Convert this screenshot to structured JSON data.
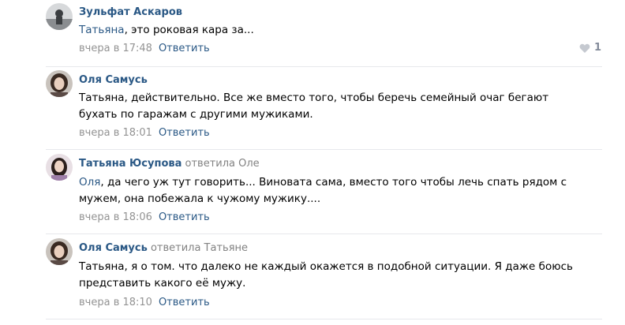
{
  "comments": [
    {
      "author": "Зульфат Аскаров",
      "reply_to": "",
      "mention": "Татьяна",
      "text": ", это роковая кара за...",
      "date": "вчера в 17:48",
      "reply_label": "Ответить",
      "likes": "1"
    },
    {
      "author": "Оля Самусь",
      "reply_to": "",
      "mention": "",
      "text_line1": "Татьяна, действительно. Все же вместо того, чтобы беречь семейный очаг бегают",
      "text_line2": "бухать по гаражам с другими мужиками.",
      "date": "вчера в 18:01",
      "reply_label": "Ответить"
    },
    {
      "author": "Татьяна Юсупова",
      "reply_to": "ответила Оле",
      "mention": "Оля",
      "text_line1": ", да чего уж тут говорить... Виновата сама, вместо того чтобы лечь спать рядом с",
      "text_line2": "мужем, она побежала к чужому мужику....",
      "date": "вчера в 18:06",
      "reply_label": "Ответить"
    },
    {
      "author": "Оля Самусь",
      "reply_to": "ответила Татьяне",
      "mention": "",
      "text_line1": "Татьяна, я о том. что далеко не каждый окажется в подобной ситуации. Я даже боюсь",
      "text_line2": "представить какого её мужу.",
      "date": "вчера в 18:10",
      "reply_label": "Ответить"
    }
  ],
  "colors": {
    "link": "#2a5885",
    "muted": "#939393",
    "separator": "#e7e8ec"
  }
}
